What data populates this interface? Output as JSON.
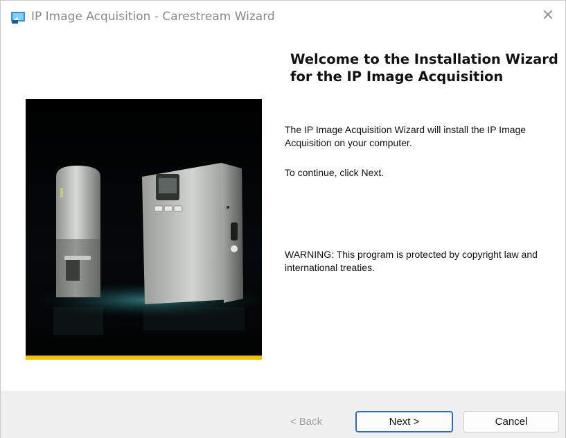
{
  "window": {
    "title": "IP Image Acquisition - Carestream Wizard",
    "close_glyph": "✕"
  },
  "content": {
    "heading": "Welcome to the Installation Wizard for the IP Image Acquisition",
    "paragraph_1": "The IP Image Acquisition Wizard will install the IP Image Acquisition on your computer.",
    "paragraph_2": "To continue, click Next.",
    "paragraph_3": "WARNING: This program is protected by copyright law and international treaties."
  },
  "buttons": {
    "back": "< Back",
    "next": "Next >",
    "cancel": "Cancel"
  },
  "icons": {
    "app": "installer-app-icon",
    "close": "close-icon"
  },
  "colors": {
    "accent": "#2a6bc4",
    "banner_stripe": "#f2c200",
    "footer_bg": "#f0f0f0"
  }
}
